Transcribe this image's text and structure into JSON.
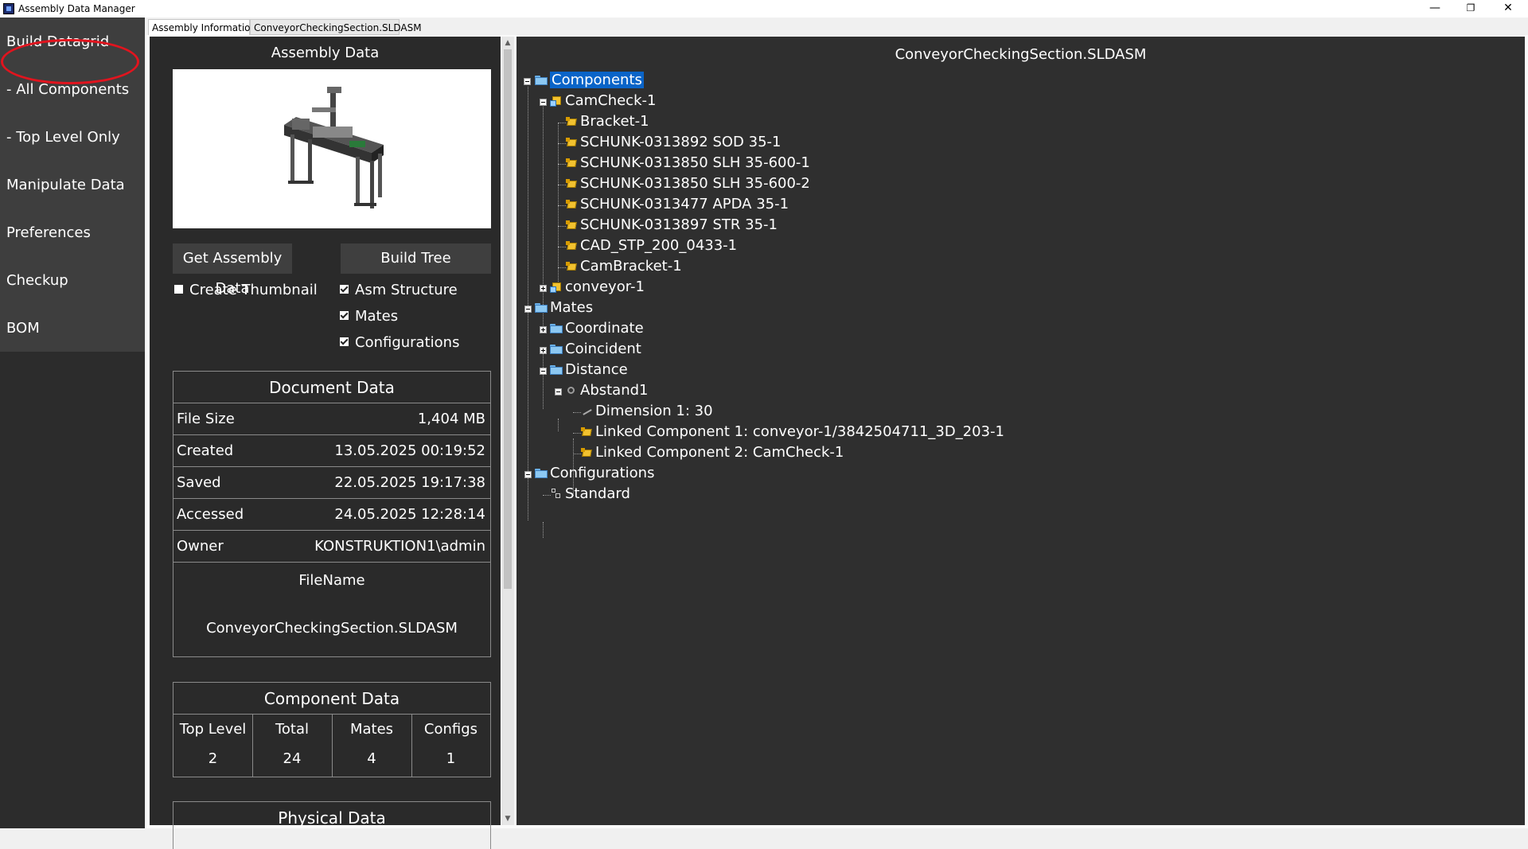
{
  "window": {
    "title": "Assembly Data Manager"
  },
  "nav": {
    "items": [
      "Build Datagrid",
      "- All Components",
      "- Top Level Only",
      "Manipulate Data",
      "Preferences",
      "Checkup",
      "BOM"
    ]
  },
  "tabs": [
    "Assembly Information",
    "ConveyorCheckingSection.SLDASM"
  ],
  "assembly": {
    "heading": "Assembly Data",
    "get_button": "Get Assembly Data",
    "build_button": "Build Tree",
    "create_thumbnail": "Create Thumbnail",
    "asm_structure": "Asm Structure",
    "mates": "Mates",
    "configurations": "Configurations"
  },
  "document": {
    "heading": "Document Data",
    "rows": [
      {
        "key": "File Size",
        "value": "1,404 MB"
      },
      {
        "key": "Created",
        "value": "13.05.2025 00:19:52"
      },
      {
        "key": "Saved",
        "value": "22.05.2025 19:17:38"
      },
      {
        "key": "Accessed",
        "value": "24.05.2025 12:28:14"
      },
      {
        "key": "Owner",
        "value": "KONSTRUKTION1\\admin"
      }
    ],
    "filename_label": "FileName",
    "filename": "ConveyorCheckingSection.SLDASM"
  },
  "component": {
    "heading": "Component Data",
    "columns": [
      {
        "label": "Top Level",
        "value": "2"
      },
      {
        "label": "Total",
        "value": "24"
      },
      {
        "label": "Mates",
        "value": "4"
      },
      {
        "label": "Configs",
        "value": "1"
      }
    ]
  },
  "physical": {
    "heading": "Physical Data"
  },
  "tree": {
    "title": "ConveyorCheckingSection.SLDASM",
    "nodes": [
      "Components",
      "CamCheck-1",
      "Bracket-1",
      "SCHUNK-0313892 SOD 35-1",
      "SCHUNK-0313850 SLH 35-600-1",
      "SCHUNK-0313850 SLH 35-600-2",
      "SCHUNK-0313477 APDA 35-1",
      "SCHUNK-0313897 STR 35-1",
      "CAD_STP_200_0433-1",
      "CamBracket-1",
      "conveyor-1",
      "Mates",
      "Coordinate",
      "Coincident",
      "Distance",
      "Abstand1",
      "Dimension 1: 30",
      "Linked Component 1: conveyor-1/3842504711_3D_203-1",
      "Linked Component 2: CamCheck-1",
      "Configurations",
      "Standard"
    ]
  },
  "colors": {
    "selection": "#0a64c8",
    "annotation_circle": "#e1141e",
    "panel_dark": "#2a2a2a"
  }
}
